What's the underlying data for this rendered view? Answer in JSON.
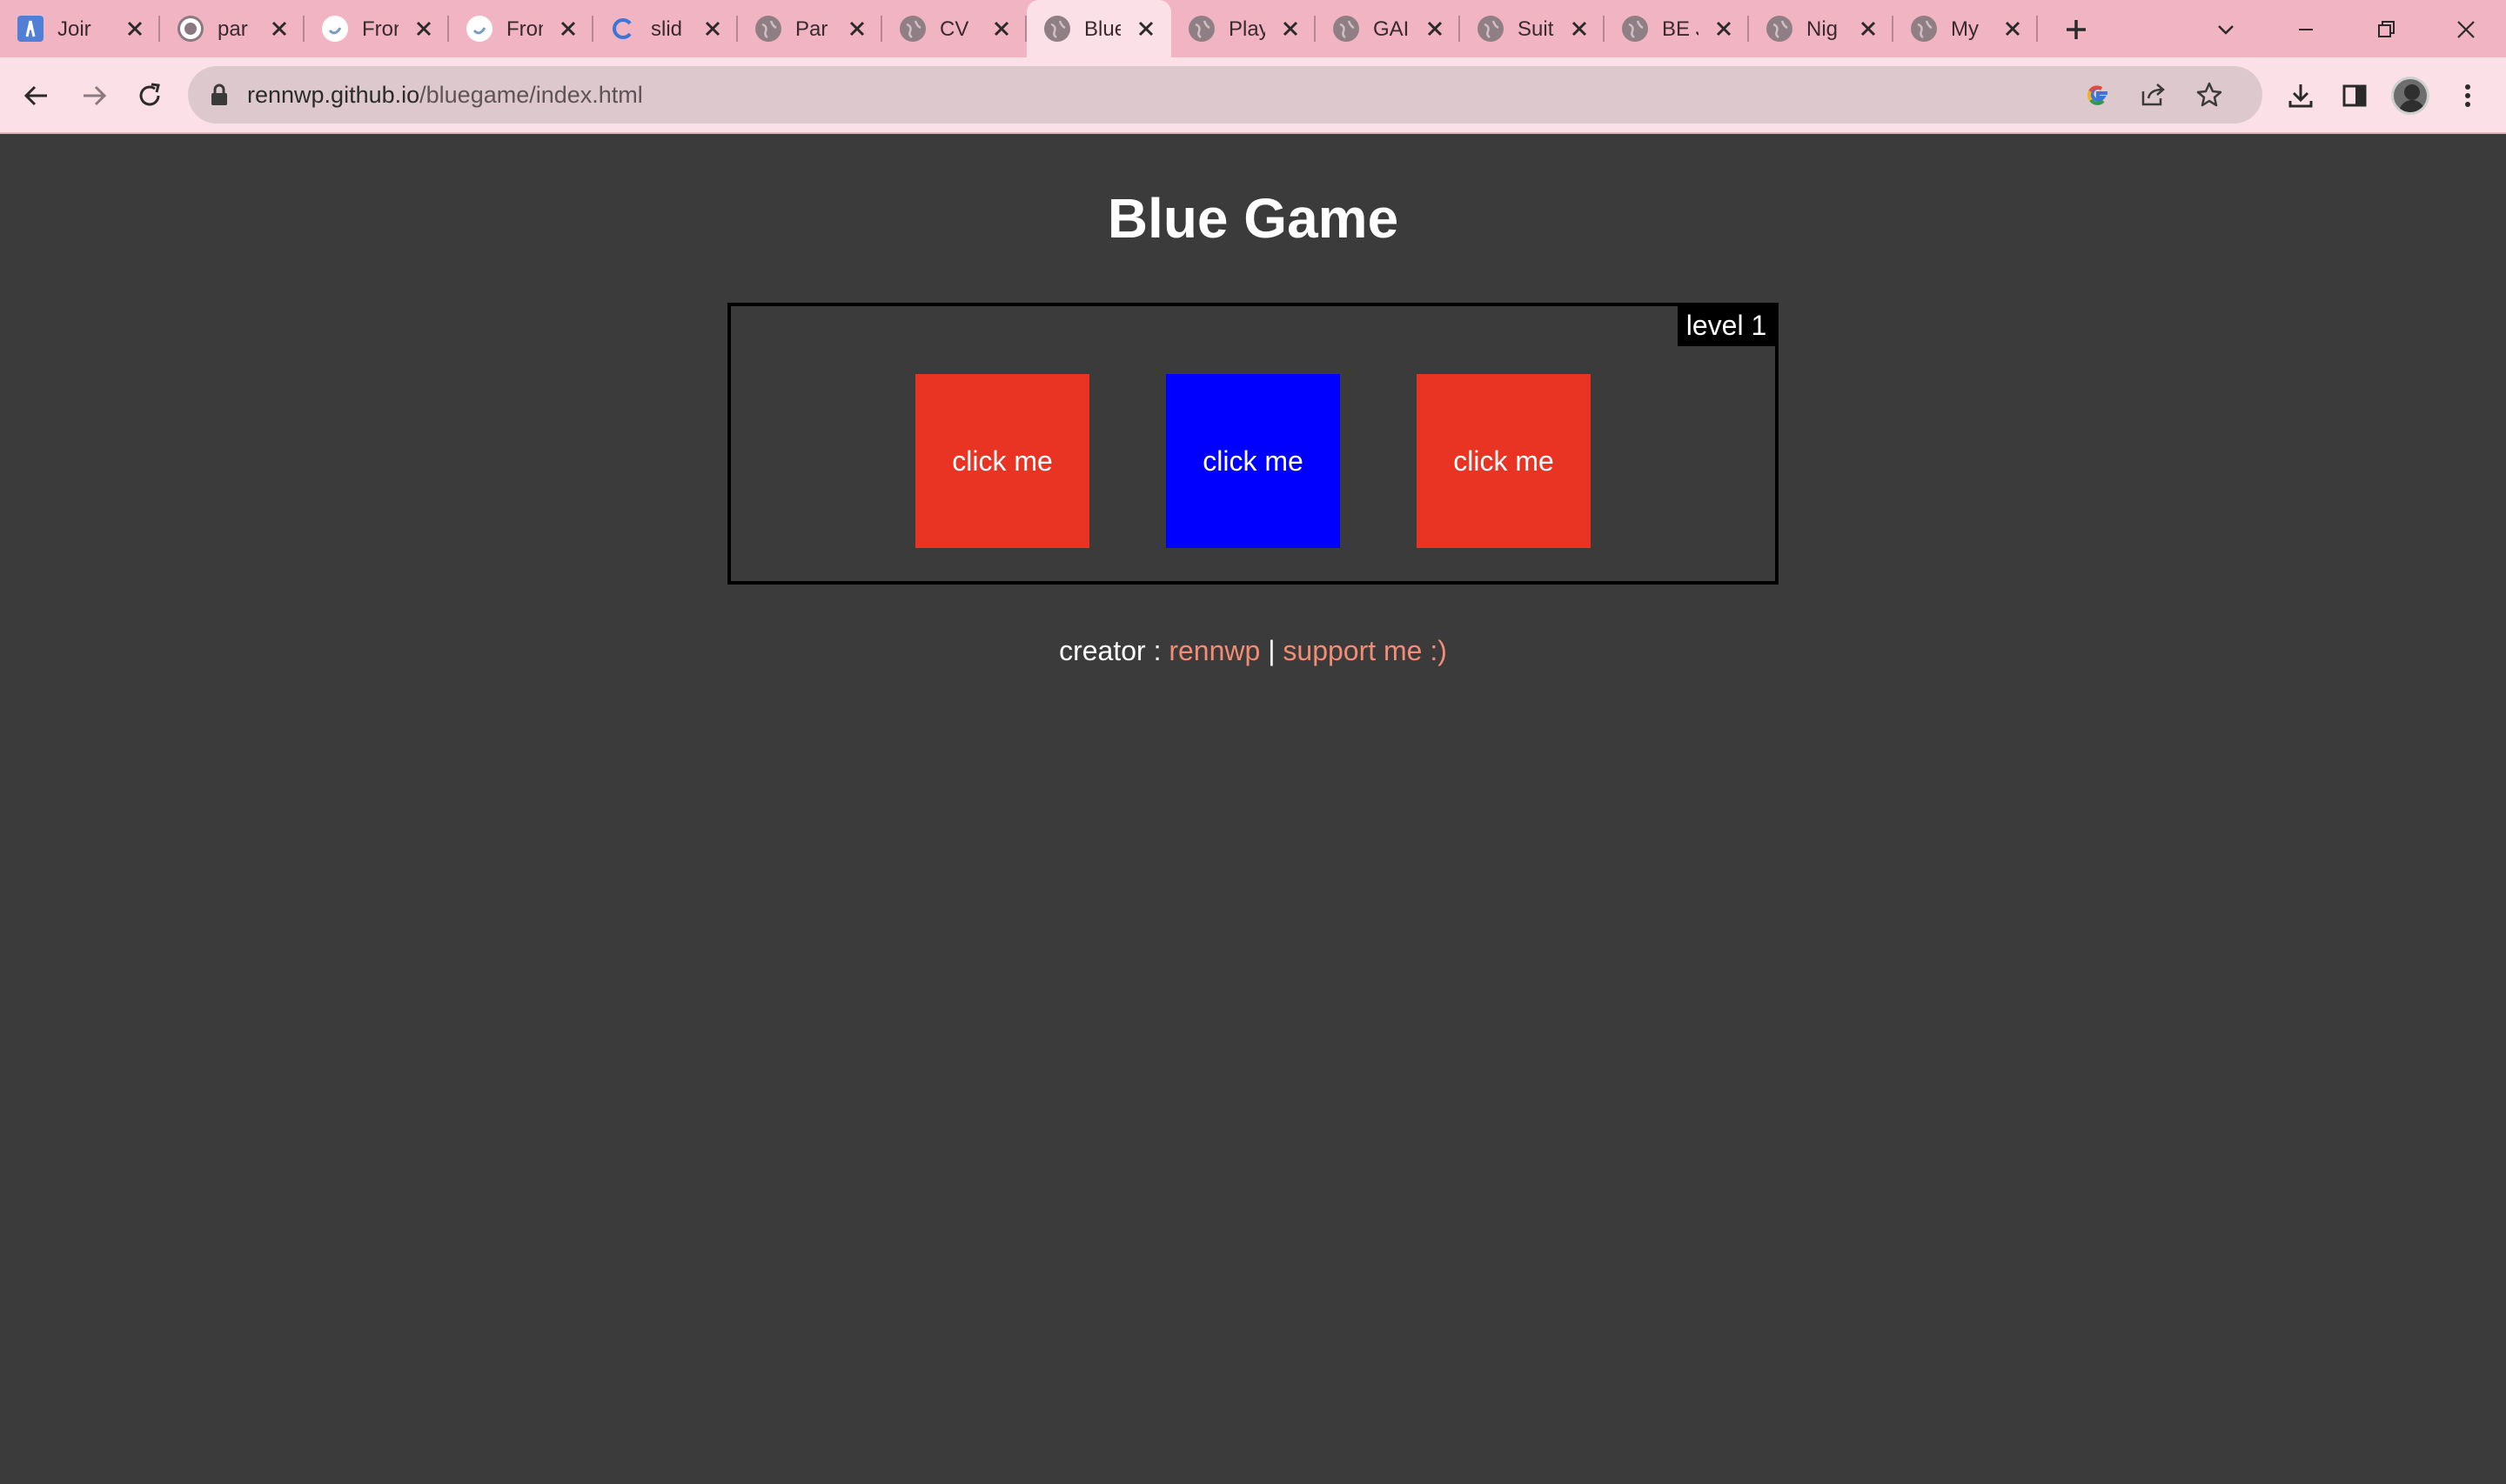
{
  "browser": {
    "tabs": [
      {
        "title": "Joir",
        "icon": "app-icon",
        "active": false
      },
      {
        "title": "par",
        "icon": "github-icon",
        "active": false
      },
      {
        "title": "Fron",
        "icon": "site-icon",
        "active": false
      },
      {
        "title": "Fron",
        "icon": "site-icon",
        "active": false
      },
      {
        "title": "slid",
        "icon": "google-icon",
        "active": false
      },
      {
        "title": "Par",
        "icon": "globe-icon",
        "active": false
      },
      {
        "title": "CV",
        "icon": "globe-icon",
        "active": false
      },
      {
        "title": "Blue",
        "icon": "globe-icon",
        "active": true
      },
      {
        "title": "Play",
        "icon": "globe-icon",
        "active": false
      },
      {
        "title": "GAI",
        "icon": "globe-icon",
        "active": false
      },
      {
        "title": "Suit",
        "icon": "globe-icon",
        "active": false
      },
      {
        "title": "BE J",
        "icon": "globe-icon",
        "active": false
      },
      {
        "title": "Nig",
        "icon": "globe-icon",
        "active": false
      },
      {
        "title": "My",
        "icon": "globe-icon",
        "active": false
      }
    ],
    "url_host": "rennwp.github.io",
    "url_path": "/bluegame/index.html",
    "colors": {
      "tabbar": "#f1b4c2",
      "toolbar": "#fbe1e7",
      "omnibox": "#ddc8cd"
    }
  },
  "page": {
    "title": "Blue Game",
    "level_label": "level 1",
    "tiles": [
      {
        "label": "click me",
        "color": "#e93323"
      },
      {
        "label": "click me",
        "color": "#0000ff"
      },
      {
        "label": "click me",
        "color": "#e93323"
      }
    ],
    "footer": {
      "creator_prefix": "creator : ",
      "creator_link": "rennwp",
      "separator": " | ",
      "support_link": "support me :)",
      "link_color": "#f28c74"
    },
    "background": "#3b3b3b"
  }
}
